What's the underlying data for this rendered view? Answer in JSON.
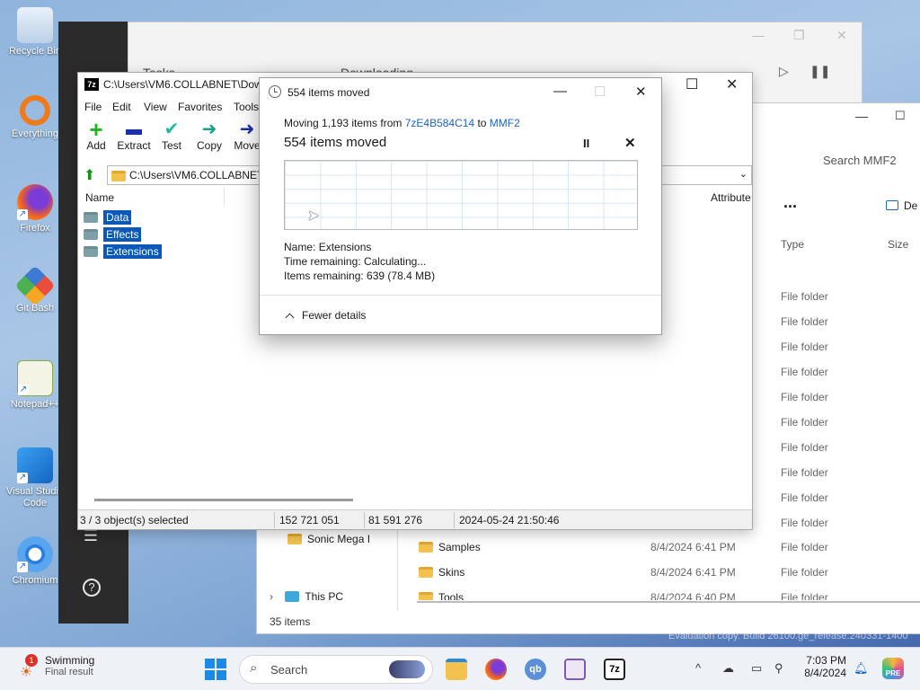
{
  "desktop": {
    "icons": [
      {
        "label": "Recycle Bin",
        "icon": "recycle-bin-icon"
      },
      {
        "label": "Everything",
        "icon": "everything-search-icon"
      },
      {
        "label": "Firefox",
        "icon": "firefox-icon"
      },
      {
        "label": "Git Bash",
        "icon": "git-bash-icon"
      },
      {
        "label": "Notepad++",
        "icon": "notepad-plus-plus-icon"
      },
      {
        "label": "Visual Studio Code",
        "icon": "vscode-icon"
      },
      {
        "label": "Chromium",
        "icon": "chromium-icon"
      }
    ]
  },
  "bg_window": {
    "left_text": "Tasks",
    "center_text": "Downloading"
  },
  "explorer": {
    "search_placeholder": "Search MMF2",
    "more": "...",
    "details_label": "De",
    "col_type": "Type",
    "col_size": "Size",
    "type_value": "File folder",
    "nav": [
      {
        "label": "Sonic Mega I",
        "icon": "folder-icon"
      },
      {
        "label": "This PC",
        "icon": "this-pc-icon"
      }
    ],
    "rows": [
      {
        "name": "Samples",
        "date": "8/4/2024 6:41 PM",
        "type": "File folder"
      },
      {
        "name": "Skins",
        "date": "8/4/2024 6:41 PM",
        "type": "File folder"
      },
      {
        "name": "Tools",
        "date": "8/4/2024 6:40 PM",
        "type": "File folder"
      }
    ],
    "status": "35 items"
  },
  "sevenzip": {
    "title": "C:\\Users\\VM6.COLLABNET\\Down",
    "badge": "7z",
    "menu": [
      "File",
      "Edit",
      "View",
      "Favorites",
      "Tools"
    ],
    "toolbar": [
      {
        "label": "Add",
        "icon": "add-icon"
      },
      {
        "label": "Extract",
        "icon": "extract-icon"
      },
      {
        "label": "Test",
        "icon": "test-icon"
      },
      {
        "label": "Copy",
        "icon": "copy-icon"
      },
      {
        "label": "Move",
        "icon": "move-icon"
      }
    ],
    "address": "C:\\Users\\VM6.COLLABNET\\",
    "col_name": "Name",
    "col_attributes": "Attribute",
    "items": [
      "Data",
      "Effects",
      "Extensions"
    ],
    "status": {
      "selected": "3 / 3 object(s) selected",
      "size": "152 721 051",
      "packed": "81 591 276",
      "modified": "2024-05-24 21:50:46"
    }
  },
  "dialog": {
    "title": "554 items moved",
    "moving_prefix": "Moving 1,193 items from ",
    "from": "7zE4B584C14",
    "to_word": " to ",
    "to": "MMF2",
    "heading": "554 items moved",
    "pause": "II",
    "cancel": "✕",
    "name_label": "Name:",
    "name_value": "Extensions",
    "time_label": "Time remaining:",
    "time_value": "Calculating...",
    "items_label": "Items remaining:",
    "items_value": "639 (78.4 MB)",
    "fewer": "Fewer details"
  },
  "taskbar": {
    "weather_title": "Swimming",
    "weather_sub": "Final result",
    "weather_badge": "1",
    "search": "Search",
    "apps": [
      "windows-start-icon",
      "file-explorer-icon",
      "firefox-icon",
      "qbittorrent-icon",
      "app-icon",
      "7zip-icon"
    ],
    "sevenzip_label": "7z",
    "qb_label": "qb",
    "time": "7:03 PM",
    "date": "8/4/2024",
    "chevron": "^",
    "pre_label": "PRE"
  },
  "watermark": "Evaluation copy. Build 26100.ge_release.240331-1400"
}
